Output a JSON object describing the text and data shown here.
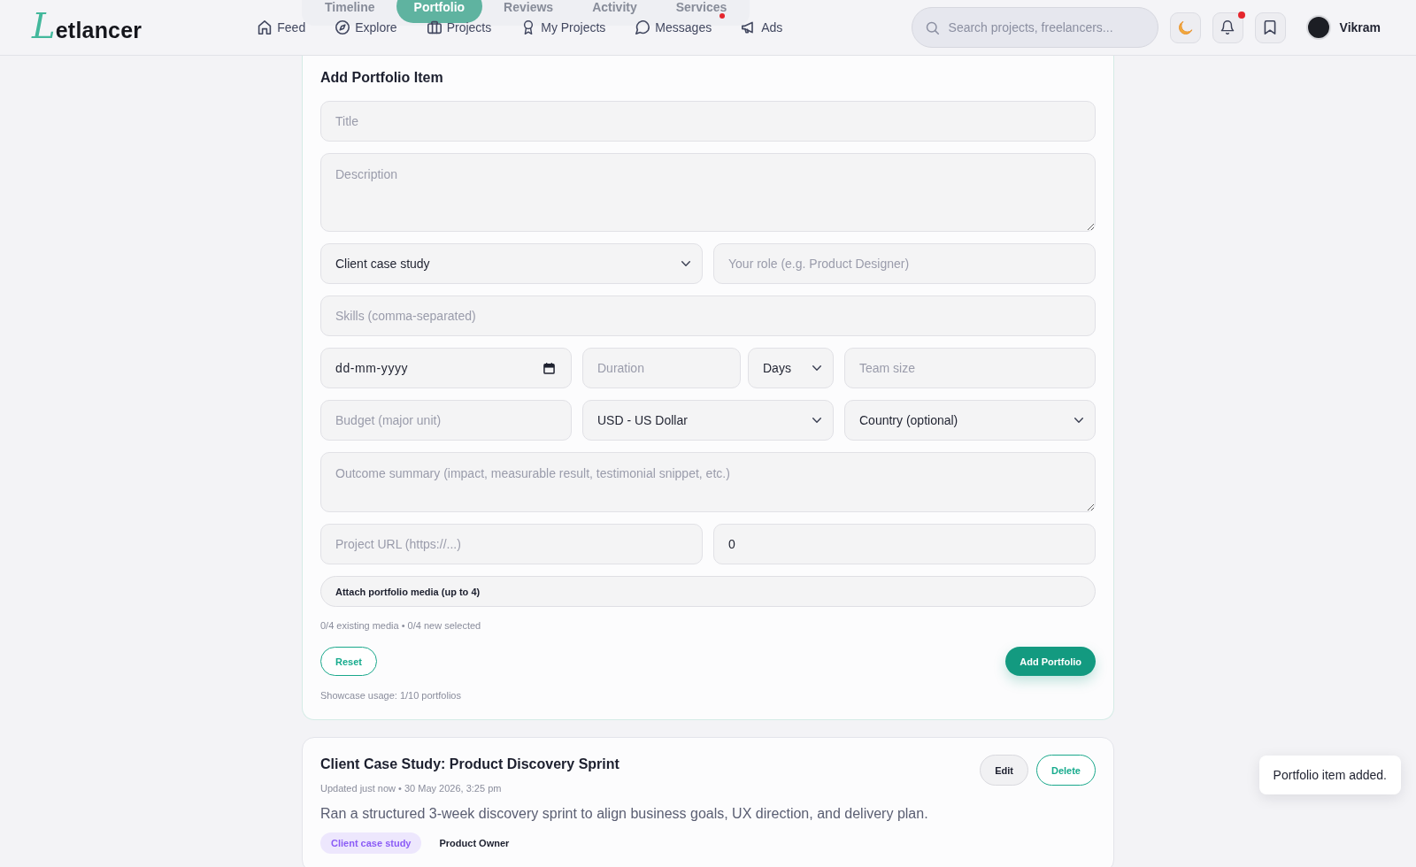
{
  "header": {
    "logo": "Letlancer",
    "nav": [
      {
        "label": "Feed",
        "unread": false
      },
      {
        "label": "Explore",
        "unread": false
      },
      {
        "label": "Projects",
        "unread": false
      },
      {
        "label": "My Projects",
        "unread": false
      },
      {
        "label": "Messages",
        "unread": true
      },
      {
        "label": "Ads",
        "unread": false
      }
    ],
    "search": {
      "placeholder": "Search projects, freelancers..."
    },
    "notifications": {
      "unread": true
    },
    "user": {
      "name": "Vikram"
    }
  },
  "profile_tabs": [
    {
      "label": "Timeline",
      "selected": false
    },
    {
      "label": "Portfolio",
      "selected": true
    },
    {
      "label": "Reviews",
      "selected": false
    },
    {
      "label": "Activity",
      "selected": false
    },
    {
      "label": "Services",
      "selected": false
    }
  ],
  "portfolio_form": {
    "title": "Add Portfolio Item",
    "rows": [
      [
        {
          "kind": "input",
          "placeholder": "Title"
        }
      ],
      [
        {
          "kind": "textarea",
          "placeholder": "Description"
        }
      ],
      [
        {
          "kind": "select",
          "value": "Client case study"
        },
        {
          "kind": "input",
          "placeholder": "Your role (e.g. Product Designer)"
        }
      ],
      [
        {
          "kind": "input",
          "placeholder": "Skills (comma-separated)"
        }
      ],
      [
        {
          "kind": "date",
          "placeholder": "dd-mm-yyyy"
        },
        {
          "kind": "group",
          "fields": [
            {
              "kind": "input",
              "placeholder": "Duration"
            },
            {
              "kind": "select",
              "value": "Days"
            }
          ]
        },
        {
          "kind": "input",
          "placeholder": "Team size"
        }
      ],
      [
        {
          "kind": "input",
          "placeholder": "Budget (major unit)"
        },
        {
          "kind": "select",
          "value": "USD - US Dollar"
        },
        {
          "kind": "select",
          "value": "Country (optional)"
        }
      ],
      [
        {
          "kind": "textarea",
          "placeholder": "Outcome summary (impact, measurable result, testimonial snippet, etc.)"
        }
      ],
      [
        {
          "kind": "input",
          "placeholder": "Project URL (https://...)"
        },
        {
          "kind": "input",
          "value": "0"
        }
      ]
    ],
    "attach_button": "Attach portfolio media (up to 4)",
    "media_status": "0/4 existing media • 0/4 new selected",
    "buttons": [
      {
        "label": "Reset",
        "kind": "outline"
      },
      {
        "label": "Add Portfolio",
        "kind": "primary"
      }
    ],
    "usage": "Showcase usage: 1/10 portfolios"
  },
  "portfolio_items": [
    {
      "title": "Client Case Study: Product Discovery Sprint",
      "meta": "Updated just now • 30 May 2026, 3:25 pm",
      "description": "Ran a structured 3-week discovery sprint to align business goals, UX direction, and delivery plan.",
      "tags": [
        {
          "label": "Client case study",
          "kind": "category"
        },
        {
          "label": "Product Owner",
          "kind": "role"
        }
      ],
      "actions": [
        {
          "label": "Edit",
          "kind": "secondary"
        },
        {
          "label": "Delete",
          "kind": "outline"
        }
      ]
    }
  ],
  "toast": {
    "message": "Portfolio item added."
  }
}
